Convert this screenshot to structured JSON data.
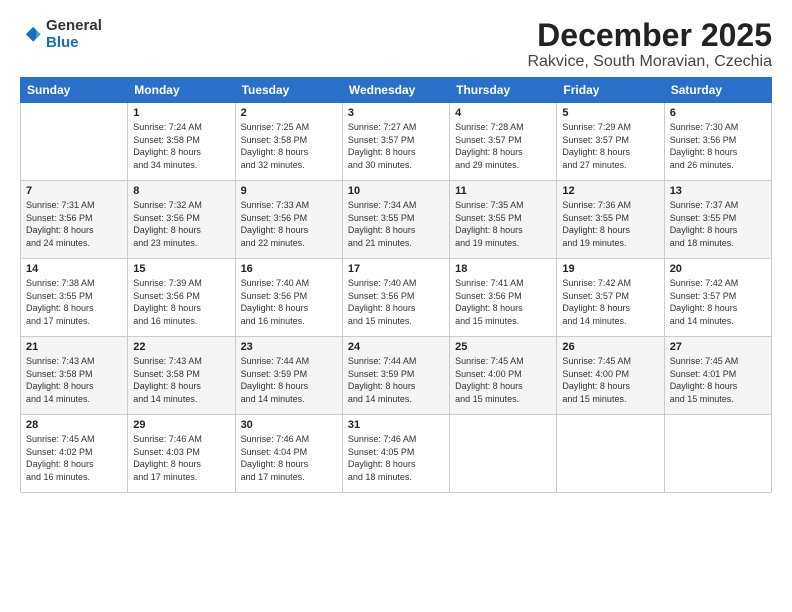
{
  "logo": {
    "general": "General",
    "blue": "Blue"
  },
  "title": {
    "month": "December 2025",
    "location": "Rakvice, South Moravian, Czechia"
  },
  "weekdays": [
    "Sunday",
    "Monday",
    "Tuesday",
    "Wednesday",
    "Thursday",
    "Friday",
    "Saturday"
  ],
  "weeks": [
    [
      {
        "day": "",
        "info": ""
      },
      {
        "day": "1",
        "info": "Sunrise: 7:24 AM\nSunset: 3:58 PM\nDaylight: 8 hours\nand 34 minutes."
      },
      {
        "day": "2",
        "info": "Sunrise: 7:25 AM\nSunset: 3:58 PM\nDaylight: 8 hours\nand 32 minutes."
      },
      {
        "day": "3",
        "info": "Sunrise: 7:27 AM\nSunset: 3:57 PM\nDaylight: 8 hours\nand 30 minutes."
      },
      {
        "day": "4",
        "info": "Sunrise: 7:28 AM\nSunset: 3:57 PM\nDaylight: 8 hours\nand 29 minutes."
      },
      {
        "day": "5",
        "info": "Sunrise: 7:29 AM\nSunset: 3:57 PM\nDaylight: 8 hours\nand 27 minutes."
      },
      {
        "day": "6",
        "info": "Sunrise: 7:30 AM\nSunset: 3:56 PM\nDaylight: 8 hours\nand 26 minutes."
      }
    ],
    [
      {
        "day": "7",
        "info": "Sunrise: 7:31 AM\nSunset: 3:56 PM\nDaylight: 8 hours\nand 24 minutes."
      },
      {
        "day": "8",
        "info": "Sunrise: 7:32 AM\nSunset: 3:56 PM\nDaylight: 8 hours\nand 23 minutes."
      },
      {
        "day": "9",
        "info": "Sunrise: 7:33 AM\nSunset: 3:56 PM\nDaylight: 8 hours\nand 22 minutes."
      },
      {
        "day": "10",
        "info": "Sunrise: 7:34 AM\nSunset: 3:55 PM\nDaylight: 8 hours\nand 21 minutes."
      },
      {
        "day": "11",
        "info": "Sunrise: 7:35 AM\nSunset: 3:55 PM\nDaylight: 8 hours\nand 19 minutes."
      },
      {
        "day": "12",
        "info": "Sunrise: 7:36 AM\nSunset: 3:55 PM\nDaylight: 8 hours\nand 19 minutes."
      },
      {
        "day": "13",
        "info": "Sunrise: 7:37 AM\nSunset: 3:55 PM\nDaylight: 8 hours\nand 18 minutes."
      }
    ],
    [
      {
        "day": "14",
        "info": "Sunrise: 7:38 AM\nSunset: 3:55 PM\nDaylight: 8 hours\nand 17 minutes."
      },
      {
        "day": "15",
        "info": "Sunrise: 7:39 AM\nSunset: 3:56 PM\nDaylight: 8 hours\nand 16 minutes."
      },
      {
        "day": "16",
        "info": "Sunrise: 7:40 AM\nSunset: 3:56 PM\nDaylight: 8 hours\nand 16 minutes."
      },
      {
        "day": "17",
        "info": "Sunrise: 7:40 AM\nSunset: 3:56 PM\nDaylight: 8 hours\nand 15 minutes."
      },
      {
        "day": "18",
        "info": "Sunrise: 7:41 AM\nSunset: 3:56 PM\nDaylight: 8 hours\nand 15 minutes."
      },
      {
        "day": "19",
        "info": "Sunrise: 7:42 AM\nSunset: 3:57 PM\nDaylight: 8 hours\nand 14 minutes."
      },
      {
        "day": "20",
        "info": "Sunrise: 7:42 AM\nSunset: 3:57 PM\nDaylight: 8 hours\nand 14 minutes."
      }
    ],
    [
      {
        "day": "21",
        "info": "Sunrise: 7:43 AM\nSunset: 3:58 PM\nDaylight: 8 hours\nand 14 minutes."
      },
      {
        "day": "22",
        "info": "Sunrise: 7:43 AM\nSunset: 3:58 PM\nDaylight: 8 hours\nand 14 minutes."
      },
      {
        "day": "23",
        "info": "Sunrise: 7:44 AM\nSunset: 3:59 PM\nDaylight: 8 hours\nand 14 minutes."
      },
      {
        "day": "24",
        "info": "Sunrise: 7:44 AM\nSunset: 3:59 PM\nDaylight: 8 hours\nand 14 minutes."
      },
      {
        "day": "25",
        "info": "Sunrise: 7:45 AM\nSunset: 4:00 PM\nDaylight: 8 hours\nand 15 minutes."
      },
      {
        "day": "26",
        "info": "Sunrise: 7:45 AM\nSunset: 4:00 PM\nDaylight: 8 hours\nand 15 minutes."
      },
      {
        "day": "27",
        "info": "Sunrise: 7:45 AM\nSunset: 4:01 PM\nDaylight: 8 hours\nand 15 minutes."
      }
    ],
    [
      {
        "day": "28",
        "info": "Sunrise: 7:45 AM\nSunset: 4:02 PM\nDaylight: 8 hours\nand 16 minutes."
      },
      {
        "day": "29",
        "info": "Sunrise: 7:46 AM\nSunset: 4:03 PM\nDaylight: 8 hours\nand 17 minutes."
      },
      {
        "day": "30",
        "info": "Sunrise: 7:46 AM\nSunset: 4:04 PM\nDaylight: 8 hours\nand 17 minutes."
      },
      {
        "day": "31",
        "info": "Sunrise: 7:46 AM\nSunset: 4:05 PM\nDaylight: 8 hours\nand 18 minutes."
      },
      {
        "day": "",
        "info": ""
      },
      {
        "day": "",
        "info": ""
      },
      {
        "day": "",
        "info": ""
      }
    ]
  ]
}
